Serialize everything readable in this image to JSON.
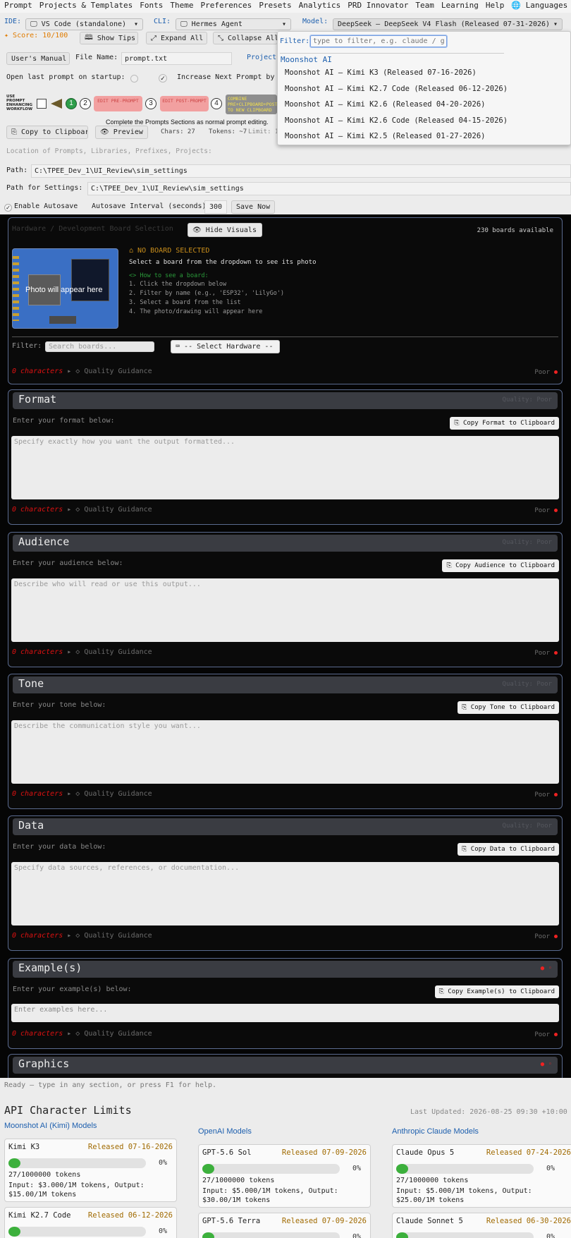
{
  "menu": [
    "Prompt",
    "Projects & Templates",
    "Fonts",
    "Theme",
    "Preferences",
    "Presets",
    "Analytics",
    "PRD Innovator",
    "Team",
    "Learning",
    "Help",
    "🌐 Languages"
  ],
  "toolbar": {
    "ide_label": "IDE:",
    "ide_value": "VS Code (standalone)",
    "cli_label": "CLI:",
    "cli_value": "Hermes Agent",
    "model_label": "Model:",
    "model_value": "DeepSeek — DeepSeek V4 Flash (Released 07-31-2026)",
    "score": "Score: 10/100",
    "show_tips": "Show Tips",
    "expand_all": "Expand All",
    "collapse_all": "Collapse All"
  },
  "dropdown": {
    "filter_label": "Filter:",
    "filter_placeholder": "type to filter, e.g. claude / gpt",
    "group": "Moonshot AI",
    "items": [
      "Moonshot AI — Kimi K3 (Released 07-16-2026)",
      "Moonshot AI — Kimi K2.7 Code (Released 06-12-2026)",
      "Moonshot AI — Kimi K2.6 (Released 04-20-2026)",
      "Moonshot AI — Kimi K2.6 Code (Released 04-15-2026)",
      "Moonshot AI — Kimi K2.5 (Released 01-27-2026)"
    ]
  },
  "file": {
    "manual": "User's Manual",
    "name_label": "File Name:",
    "name_value": "prompt.txt",
    "project_label": "Project"
  },
  "options": {
    "open_last": "Open last prompt on startup:",
    "increase_next": "Increase Next Prompt by"
  },
  "workflow": {
    "label": "USE PROMPT ENHANCING WORKFLOW",
    "step1": "1",
    "step2": "2",
    "edit_pre": "EDIT PRE-PROMPT",
    "step3": "3",
    "edit_post": "EDIT POST-PROMPT",
    "step4": "4",
    "combine": "COMBINE PRE+CLIPBOARD+POST TO NEW CLIPBOARD",
    "hint": "Complete the Prompts Sections as normal prompt editing."
  },
  "actions": {
    "copy": "Copy to Clipboard",
    "preview": "Preview",
    "chars": "Chars: 27",
    "tokens": "Tokens: ~7",
    "limit": "Limit: 1"
  },
  "paths": {
    "location": "Location of Prompts, Libraries, Prefixes, Projects:",
    "path_label": "Path:",
    "path_value": "C:\\TPEE_Dev_1\\UI_Review\\sim_settings",
    "settings_label": "Path for Settings:",
    "settings_value": "C:\\TPEE_Dev_1\\UI_Review\\sim_settings"
  },
  "autosave": {
    "enable": "Enable Autosave",
    "interval_label": "Autosave Interval (seconds):",
    "interval": "300",
    "save_now": "Save Now"
  },
  "hardware": {
    "title": "Hardware / Development Board Selection",
    "hide": "Hide Visuals",
    "available": "230 boards available",
    "photo": "Photo will appear here",
    "no_board": "NO BOARD SELECTED",
    "select_msg": "Select a board from the dropdown to see its photo",
    "howto_title": "How to see a board:",
    "howto": [
      "1. Click the dropdown below",
      "2. Filter by name (e.g., 'ESP32', 'LilyGo')",
      "3. Select a board from the list",
      "4. The photo/drawing will appear here"
    ],
    "filter_label": "Filter:",
    "filter_placeholder": "Search boards...",
    "select_hw": "-- Select Hardware --",
    "chars": "0 characters",
    "guidance": "Quality Guidance",
    "poor": "Poor"
  },
  "sections": [
    {
      "title": "Format",
      "quality": "Quality: Poor",
      "enter": "Enter your format below:",
      "copy": "Copy Format to Clipboard",
      "placeholder": "Specify exactly how you want the output formatted...",
      "chars": "0 characters",
      "guidance": "Quality Guidance",
      "poor": "Poor"
    },
    {
      "title": "Audience",
      "quality": "Quality: Poor",
      "enter": "Enter your audience below:",
      "copy": "Copy Audience to Clipboard",
      "placeholder": "Describe who will read or use this output...",
      "chars": "0 characters",
      "guidance": "Quality Guidance",
      "poor": "Poor"
    },
    {
      "title": "Tone",
      "quality": "Quality: Poor",
      "enter": "Enter your tone below:",
      "copy": "Copy Tone to Clipboard",
      "placeholder": "Describe the communication style you want...",
      "chars": "0 characters",
      "guidance": "Quality Guidance",
      "poor": "Poor"
    },
    {
      "title": "Data",
      "quality": "Quality: Poor",
      "enter": "Enter your data below:",
      "copy": "Copy Data to Clipboard",
      "placeholder": "Specify data sources, references, or documentation...",
      "chars": "0 characters",
      "guidance": "Quality Guidance",
      "poor": "Poor"
    },
    {
      "title": "Example(s)",
      "enter": "Enter your example(s) below:",
      "copy": "Copy Example(s) to Clipboard",
      "placeholder": "Enter examples here...",
      "chars": "0 characters",
      "guidance": "Quality Guidance",
      "poor": "Poor"
    },
    {
      "title": "Graphics"
    }
  ],
  "status": "Ready — type in any section, or press F1 for help.",
  "limits": {
    "title": "API Character Limits",
    "updated": "Last Updated: 2026-08-25 09:30 +10:00",
    "columns": [
      {
        "title": "Moonshot AI (Kimi) Models",
        "cards": [
          {
            "name": "Kimi K3",
            "released": "Released 07-16-2026",
            "usage": 0.0,
            "pct": "0%",
            "tokens": "27/1000000 tokens",
            "price": "Input: $3.000/1M tokens, Output: $15.00/1M tokens"
          },
          {
            "name": "Kimi K2.7 Code",
            "released": "Released 06-12-2026",
            "usage": 0.0,
            "pct": "0%"
          }
        ]
      },
      {
        "title": "OpenAI Models",
        "cards": [
          {
            "name": "GPT-5.6 Sol",
            "released": "Released 07-09-2026",
            "usage": 0.0,
            "pct": "0%",
            "tokens": "27/1000000 tokens",
            "price": "Input: $5.000/1M tokens, Output: $30.00/1M tokens"
          },
          {
            "name": "GPT-5.6 Terra",
            "released": "Released 07-09-2026",
            "usage": 0.0,
            "pct": "0%"
          }
        ]
      },
      {
        "title": "Anthropic Claude Models",
        "cards": [
          {
            "name": "Claude Opus 5",
            "released": "Released 07-24-2026",
            "usage": 0.0,
            "pct": "0%",
            "tokens": "27/1000000 tokens",
            "price": "Input: $5.000/1M tokens, Output: $25.00/1M tokens"
          },
          {
            "name": "Claude Sonnet 5",
            "released": "Released 06-30-2026",
            "usage": 0.0,
            "pct": "0%"
          }
        ]
      }
    ]
  },
  "colors": {
    "accent": "#1d5fae",
    "score": "#e07b00",
    "poor": "#dd1111",
    "panel_border": "#5a6a8e"
  }
}
